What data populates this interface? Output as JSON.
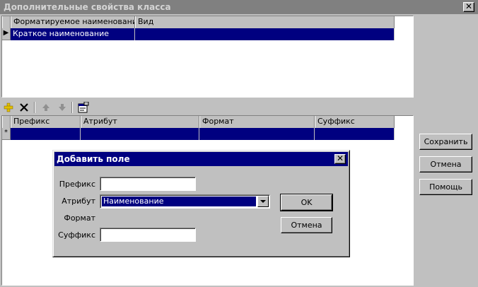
{
  "window": {
    "title": "Дополнительные свойства класса",
    "close_glyph": "✕"
  },
  "top_grid": {
    "columns": [
      "Форматируемое наименование",
      "Вид"
    ],
    "rows": [
      {
        "indicator": "▶",
        "cells": [
          "Краткое наименование",
          ""
        ]
      }
    ]
  },
  "toolbar": {
    "icons": [
      "add-icon",
      "delete-icon",
      "move-up-icon",
      "move-down-icon",
      "properties-icon"
    ]
  },
  "bottom_grid": {
    "columns": [
      "Префикс",
      "Атрибут",
      "Формат",
      "Суффикс"
    ],
    "rows": [
      {
        "indicator": "*",
        "cells": [
          "",
          "",
          "",
          ""
        ]
      }
    ]
  },
  "side_buttons": {
    "save": "Сохранить",
    "cancel": "Отмена",
    "help": "Помощь"
  },
  "dialog": {
    "title": "Добавить поле",
    "close_glyph": "✕",
    "prefix_label": "Префикс",
    "prefix_value": "",
    "attribute_label": "Атрибут",
    "attribute_value": "Наименование",
    "format_label": "Формат",
    "suffix_label": "Суффикс",
    "suffix_value": "",
    "ok": "OK",
    "cancel": "Отмена"
  },
  "colors": {
    "selection": "#000080",
    "face": "#c0c0c0",
    "inactive_title": "#808080",
    "add_icon": "#e0c000"
  }
}
